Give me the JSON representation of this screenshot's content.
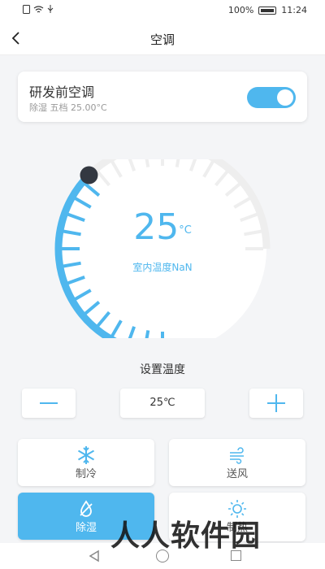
{
  "status_bar": {
    "battery": "100%",
    "time": "11:24"
  },
  "header": {
    "title": "空调",
    "back_icon": "chevron-left-icon"
  },
  "device": {
    "name": "研发前空调",
    "status": "除湿 五档 25.00°C",
    "power_on": true
  },
  "dial": {
    "temperature": "25",
    "unit": "°C",
    "indoor_label": "室内温度NaN",
    "level": 0.5,
    "active_color": "#4fb7ee",
    "inactive_color": "#eeeeee"
  },
  "setpoint": {
    "title": "设置温度",
    "value": "25℃"
  },
  "modes": [
    {
      "label": "制冷",
      "icon": "snowflake-icon",
      "active": false
    },
    {
      "label": "送风",
      "icon": "wind-icon",
      "active": false
    },
    {
      "label": "除湿",
      "icon": "droplet-icon",
      "active": true
    },
    {
      "label": "制热",
      "icon": "sun-icon",
      "active": false
    }
  ],
  "watermark": "人人软件园"
}
